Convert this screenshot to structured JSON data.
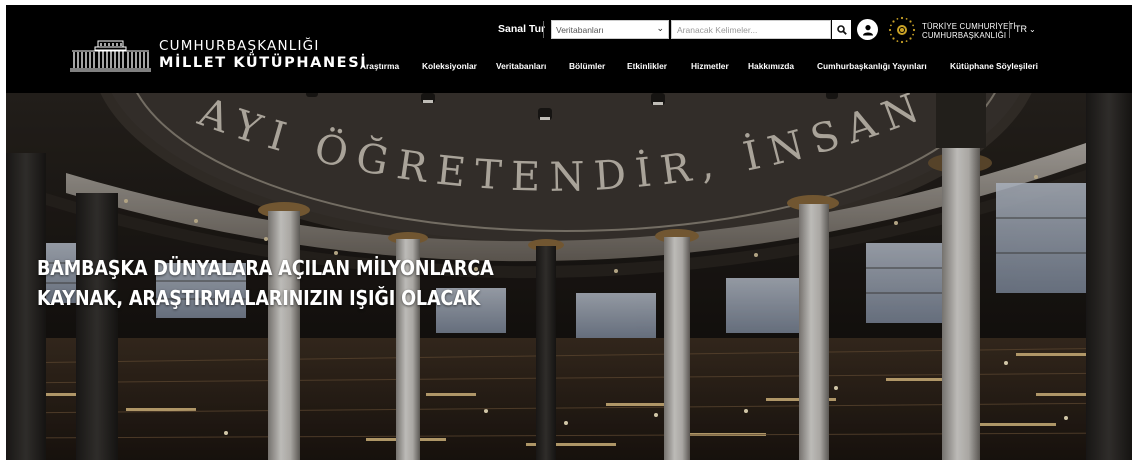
{
  "brand": {
    "line1": "CUMHURBAŞKANLIĞI",
    "line2": "MİLLET KÜTÜPHANESİ"
  },
  "topbar": {
    "sanal_tur": "Sanal Tur",
    "db_select_value": "Veritabanları",
    "search_placeholder": "Aranacak Kelimeler...",
    "presidency_line1": "TÜRKİYE CUMHURİYETİ",
    "presidency_line2": "CUMHURBAŞKANLIĞI",
    "lang": "TR"
  },
  "nav": {
    "items": [
      {
        "label": "Araştırma"
      },
      {
        "label": "Koleksiyonlar"
      },
      {
        "label": "Veritabanları"
      },
      {
        "label": "Bölümler"
      },
      {
        "label": "Etkinlikler"
      },
      {
        "label": "Hizmetler"
      },
      {
        "label": "Hakkımızda"
      },
      {
        "label": "Cumhurbaşkanlığı Yayınları"
      },
      {
        "label": "Kütüphane Söyleşileri"
      }
    ]
  },
  "hero": {
    "headline_line1": "BAMBAŞKA DÜNYALARA AÇILAN MİLYONLARCA",
    "headline_line2": "KAYNAK, ARAŞTIRMALARINIZIN IŞIĞI OLACAK",
    "dome_inscription": "AYI ÖĞRETENDİR, İNSAN"
  },
  "icons": {
    "search": "search-icon",
    "user": "user-icon",
    "emblem": "presidential-emblem-icon",
    "chevron": "chevron-down-icon"
  },
  "colors": {
    "header_bg": "#000000",
    "text": "#ffffff"
  }
}
